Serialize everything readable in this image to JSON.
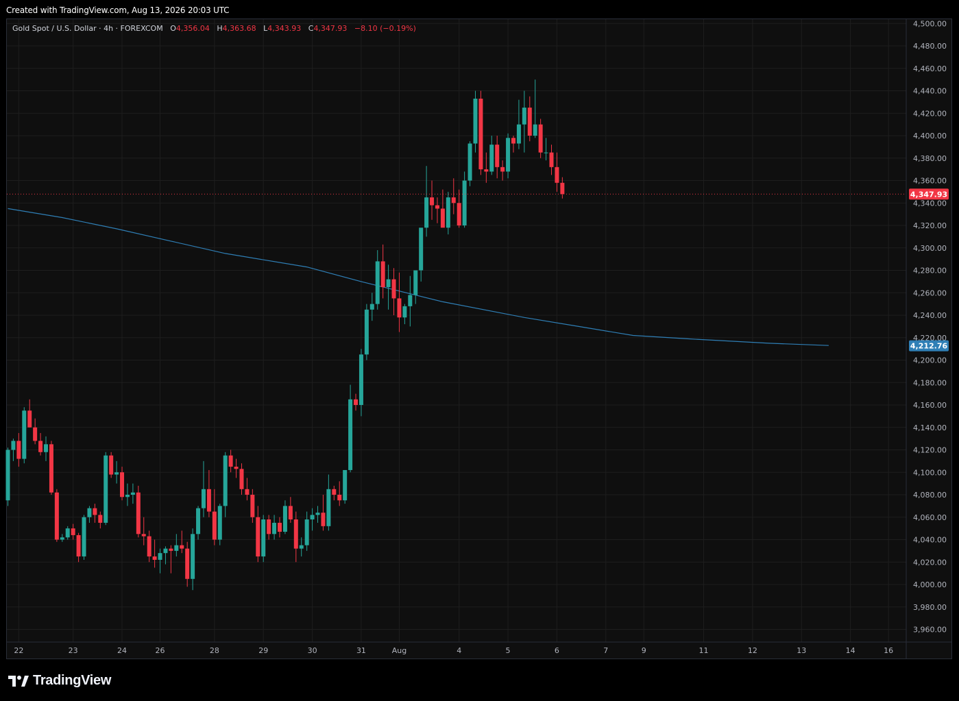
{
  "watermark_top": "Created with TradingView.com, Aug 13, 2026 20:03 UTC",
  "brand": {
    "name": "TradingView"
  },
  "legend": {
    "symbol": "Gold Spot / U.S. Dollar · 4h · FOREXCOM",
    "o_label": "O",
    "o_value": "4,356.04",
    "h_label": "H",
    "h_value": "4,363.68",
    "l_label": "L",
    "l_value": "4,343.93",
    "c_label": "C",
    "c_value": "4,347.93",
    "change": "−8.10 (−0.19%)"
  },
  "colors": {
    "up": "#26a69a",
    "down": "#f23645",
    "ma": "#2f7fb6",
    "bg": "#0f0f0f",
    "grid": "#1e1e1e"
  },
  "chart_data": {
    "type": "candlestick",
    "timeframe": "4h",
    "ylim": [
      3950,
      4505
    ],
    "y_ticks": [
      "3,960.00",
      "3,980.00",
      "4,000.00",
      "4,020.00",
      "4,040.00",
      "4,060.00",
      "4,080.00",
      "4,100.00",
      "4,120.00",
      "4,140.00",
      "4,160.00",
      "4,180.00",
      "4,200.00",
      "4,220.00",
      "4,240.00",
      "4,260.00",
      "4,280.00",
      "4,300.00",
      "4,320.00",
      "4,340.00",
      "4,360.00",
      "4,380.00",
      "4,400.00",
      "4,420.00",
      "4,440.00",
      "4,460.00",
      "4,480.00",
      "4,500.00"
    ],
    "y_tick_values": [
      3960,
      3980,
      4000,
      4020,
      4040,
      4060,
      4080,
      4100,
      4120,
      4140,
      4160,
      4180,
      4200,
      4220,
      4240,
      4260,
      4280,
      4300,
      4320,
      4340,
      4360,
      4380,
      4400,
      4420,
      4440,
      4460,
      4480,
      4500
    ],
    "x_ticks": [
      {
        "label": "22",
        "bar": 2
      },
      {
        "label": "23",
        "bar": 12
      },
      {
        "label": "24",
        "bar": 21
      },
      {
        "label": "26",
        "bar": 28
      },
      {
        "label": "28",
        "bar": 38
      },
      {
        "label": "29",
        "bar": 47
      },
      {
        "label": "30",
        "bar": 56
      },
      {
        "label": "31",
        "bar": 65
      },
      {
        "label": "Aug",
        "bar": 72
      },
      {
        "label": "4",
        "bar": 83
      },
      {
        "label": "5",
        "bar": 92
      },
      {
        "label": "6",
        "bar": 101
      },
      {
        "label": "7",
        "bar": 110
      },
      {
        "label": "9",
        "bar": 117
      },
      {
        "label": "11",
        "bar": 128
      },
      {
        "label": "12",
        "bar": 137
      },
      {
        "label": "13",
        "bar": 146
      },
      {
        "label": "14",
        "bar": 155
      },
      {
        "label": "16",
        "bar": 162
      }
    ],
    "last_price": 4347.93,
    "last_price_label": "4,347.93",
    "ma_last": 4212.76,
    "ma_last_label": "4,212.76",
    "ma_line": [
      {
        "bar": 0,
        "value": 4335
      },
      {
        "bar": 10,
        "value": 4327
      },
      {
        "bar": 20,
        "value": 4317
      },
      {
        "bar": 30,
        "value": 4306
      },
      {
        "bar": 40,
        "value": 4295
      },
      {
        "bar": 55,
        "value": 4283
      },
      {
        "bar": 65,
        "value": 4270
      },
      {
        "bar": 80,
        "value": 4252
      },
      {
        "bar": 95,
        "value": 4238
      },
      {
        "bar": 105,
        "value": 4230
      },
      {
        "bar": 115,
        "value": 4222
      },
      {
        "bar": 125,
        "value": 4219
      },
      {
        "bar": 140,
        "value": 4215
      },
      {
        "bar": 151,
        "value": 4213
      }
    ],
    "candles": [
      [
        4075,
        4122,
        4070,
        4120
      ],
      [
        4120,
        4130,
        4110,
        4128
      ],
      [
        4128,
        4135,
        4105,
        4112
      ],
      [
        4112,
        4158,
        4108,
        4155
      ],
      [
        4155,
        4165,
        4140,
        4140
      ],
      [
        4140,
        4148,
        4125,
        4128
      ],
      [
        4128,
        4135,
        4115,
        4118
      ],
      [
        4118,
        4132,
        4110,
        4125
      ],
      [
        4125,
        4128,
        4080,
        4082
      ],
      [
        4082,
        4085,
        4038,
        4040
      ],
      [
        4040,
        4045,
        4038,
        4042
      ],
      [
        4042,
        4052,
        4040,
        4050
      ],
      [
        4050,
        4054,
        4040,
        4044
      ],
      [
        4044,
        4046,
        4020,
        4025
      ],
      [
        4025,
        4062,
        4022,
        4060
      ],
      [
        4060,
        4070,
        4055,
        4068
      ],
      [
        4068,
        4072,
        4055,
        4062
      ],
      [
        4062,
        4065,
        4050,
        4055
      ],
      [
        4055,
        4118,
        4053,
        4115
      ],
      [
        4115,
        4118,
        4095,
        4098
      ],
      [
        4098,
        4110,
        4090,
        4100
      ],
      [
        4100,
        4105,
        4075,
        4078
      ],
      [
        4078,
        4090,
        4070,
        4080
      ],
      [
        4080,
        4090,
        4072,
        4082
      ],
      [
        4082,
        4088,
        4042,
        4045
      ],
      [
        4045,
        4060,
        4035,
        4043
      ],
      [
        4043,
        4048,
        4020,
        4025
      ],
      [
        4025,
        4040,
        4015,
        4022
      ],
      [
        4022,
        4032,
        4010,
        4028
      ],
      [
        4028,
        4034,
        4018,
        4032
      ],
      [
        4032,
        4035,
        4010,
        4030
      ],
      [
        4030,
        4045,
        4025,
        4035
      ],
      [
        4035,
        4048,
        4028,
        4032
      ],
      [
        4032,
        4038,
        3998,
        4005
      ],
      [
        4005,
        4050,
        3995,
        4045
      ],
      [
        4045,
        4070,
        4040,
        4068
      ],
      [
        4068,
        4110,
        4060,
        4085
      ],
      [
        4085,
        4102,
        4060,
        4065
      ],
      [
        4065,
        4085,
        4035,
        4040
      ],
      [
        4040,
        4072,
        4035,
        4070
      ],
      [
        4070,
        4118,
        4060,
        4115
      ],
      [
        4115,
        4120,
        4100,
        4105
      ],
      [
        4105,
        4112,
        4095,
        4103
      ],
      [
        4103,
        4108,
        4080,
        4085
      ],
      [
        4085,
        4095,
        4075,
        4080
      ],
      [
        4080,
        4085,
        4055,
        4060
      ],
      [
        4060,
        4070,
        4020,
        4025
      ],
      [
        4025,
        4062,
        4020,
        4058
      ],
      [
        4058,
        4062,
        4040,
        4045
      ],
      [
        4045,
        4062,
        4040,
        4055
      ],
      [
        4055,
        4060,
        4042,
        4047
      ],
      [
        4047,
        4075,
        4045,
        4070
      ],
      [
        4070,
        4078,
        4055,
        4058
      ],
      [
        4058,
        4065,
        4020,
        4032
      ],
      [
        4032,
        4042,
        4025,
        4035
      ],
      [
        4035,
        4065,
        4030,
        4058
      ],
      [
        4058,
        4068,
        4048,
        4062
      ],
      [
        4062,
        4070,
        4055,
        4064
      ],
      [
        4064,
        4080,
        4048,
        4052
      ],
      [
        4052,
        4098,
        4048,
        4085
      ],
      [
        4085,
        4088,
        4075,
        4080
      ],
      [
        4080,
        4092,
        4070,
        4075
      ],
      [
        4075,
        4102,
        4072,
        4102
      ],
      [
        4102,
        4178,
        4100,
        4165
      ],
      [
        4165,
        4170,
        4155,
        4160
      ],
      [
        4160,
        4210,
        4150,
        4205
      ],
      [
        4205,
        4250,
        4200,
        4245
      ],
      [
        4245,
        4260,
        4235,
        4250
      ],
      [
        4250,
        4298,
        4245,
        4288
      ],
      [
        4288,
        4303,
        4255,
        4265
      ],
      [
        4265,
        4285,
        4245,
        4272
      ],
      [
        4272,
        4282,
        4240,
        4255
      ],
      [
        4255,
        4278,
        4225,
        4238
      ],
      [
        4238,
        4250,
        4232,
        4248
      ],
      [
        4248,
        4275,
        4230,
        4258
      ],
      [
        4258,
        4280,
        4250,
        4280
      ],
      [
        4280,
        4310,
        4270,
        4318
      ],
      [
        4318,
        4373,
        4310,
        4345
      ],
      [
        4345,
        4360,
        4325,
        4338
      ],
      [
        4338,
        4345,
        4322,
        4335
      ],
      [
        4335,
        4352,
        4320,
        4318
      ],
      [
        4318,
        4350,
        4312,
        4345
      ],
      [
        4345,
        4362,
        4330,
        4340
      ],
      [
        4340,
        4352,
        4318,
        4320
      ],
      [
        4320,
        4368,
        4318,
        4360
      ],
      [
        4360,
        4395,
        4355,
        4393
      ],
      [
        4393,
        4440,
        4385,
        4433
      ],
      [
        4433,
        4440,
        4365,
        4370
      ],
      [
        4370,
        4385,
        4358,
        4368
      ],
      [
        4368,
        4400,
        4365,
        4392
      ],
      [
        4392,
        4400,
        4362,
        4372
      ],
      [
        4372,
        4378,
        4360,
        4368
      ],
      [
        4368,
        4402,
        4362,
        4398
      ],
      [
        4398,
        4400,
        4385,
        4393
      ],
      [
        4393,
        4432,
        4388,
        4410
      ],
      [
        4410,
        4440,
        4385,
        4425
      ],
      [
        4425,
        4435,
        4395,
        4400
      ],
      [
        4400,
        4450,
        4398,
        4410
      ],
      [
        4410,
        4415,
        4380,
        4385
      ],
      [
        4385,
        4398,
        4378,
        4385
      ],
      [
        4385,
        4392,
        4365,
        4372
      ],
      [
        4372,
        4385,
        4350,
        4358
      ],
      [
        4358,
        4363,
        4344,
        4348
      ]
    ]
  }
}
